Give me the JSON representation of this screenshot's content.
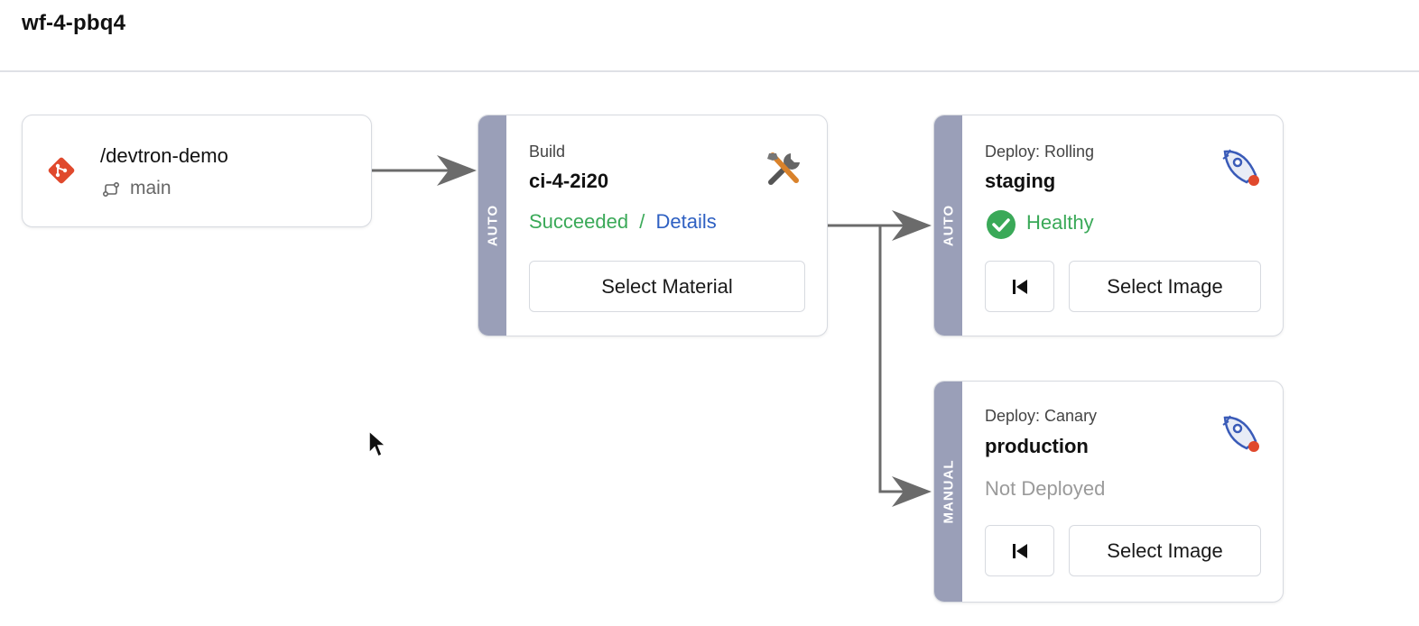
{
  "workflow": {
    "name": "wf-4-pbq4"
  },
  "source": {
    "repo": "/devtron-demo",
    "branch": "main"
  },
  "build": {
    "trigger": "AUTO",
    "type": "Build",
    "name": "ci-4-2i20",
    "status": "Succeeded",
    "separator": "/",
    "details_link": "Details",
    "button": "Select Material"
  },
  "deploy_staging": {
    "trigger": "AUTO",
    "type": "Deploy: Rolling",
    "name": "staging",
    "status": "Healthy",
    "button": "Select Image"
  },
  "deploy_production": {
    "trigger": "MANUAL",
    "type": "Deploy: Canary",
    "name": "production",
    "status": "Not Deployed",
    "button": "Select Image"
  },
  "icons": {
    "git": "git-icon",
    "branch": "branch-icon",
    "build": "tools-icon",
    "deploy": "rocket-icon",
    "healthy": "check-circle-icon",
    "rollback": "rollback-icon"
  },
  "colors": {
    "success": "#3aa958",
    "link": "#2e60c2",
    "muted": "#9a9a9a",
    "trigger_bar": "#9a9fb8",
    "git": "#e0492d"
  }
}
